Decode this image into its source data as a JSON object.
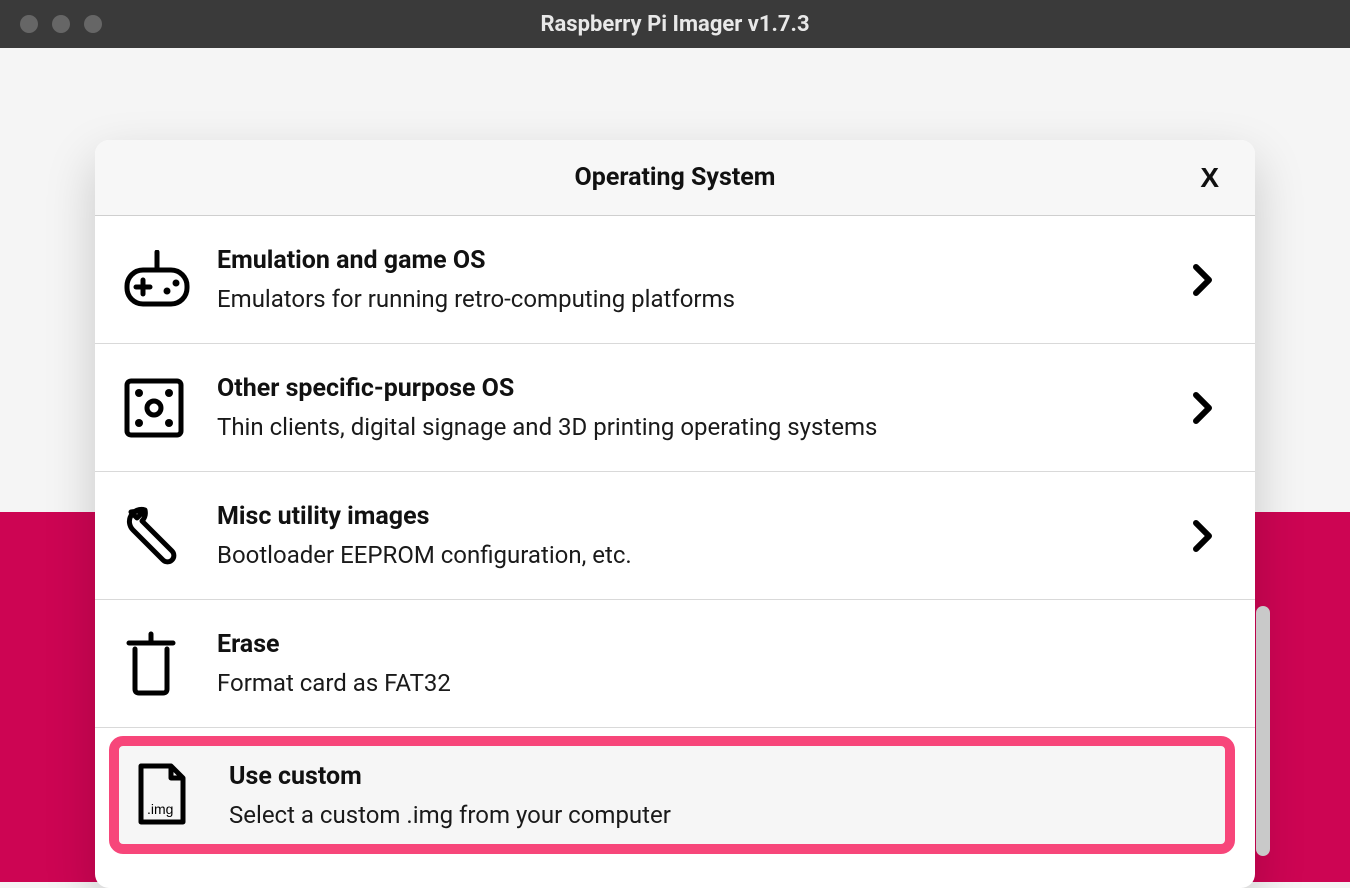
{
  "window": {
    "title": "Raspberry Pi Imager v1.7.3"
  },
  "dialog": {
    "title": "Operating System",
    "close_label": "X"
  },
  "items": [
    {
      "title": "Emulation and game OS",
      "desc": "Emulators for running retro-computing platforms",
      "icon": "gamepad-icon",
      "has_chevron": true,
      "highlight": false
    },
    {
      "title": "Other specific-purpose OS",
      "desc": "Thin clients, digital signage and 3D printing operating systems",
      "icon": "dice-icon",
      "has_chevron": true,
      "highlight": false
    },
    {
      "title": "Misc utility images",
      "desc": "Bootloader EEPROM configuration, etc.",
      "icon": "wrench-icon",
      "has_chevron": true,
      "highlight": false
    },
    {
      "title": "Erase",
      "desc": "Format card as FAT32",
      "icon": "trash-icon",
      "has_chevron": false,
      "highlight": false
    },
    {
      "title": "Use custom",
      "desc": "Select a custom .img from your computer",
      "icon": "img-file-icon",
      "has_chevron": false,
      "highlight": true
    }
  ]
}
